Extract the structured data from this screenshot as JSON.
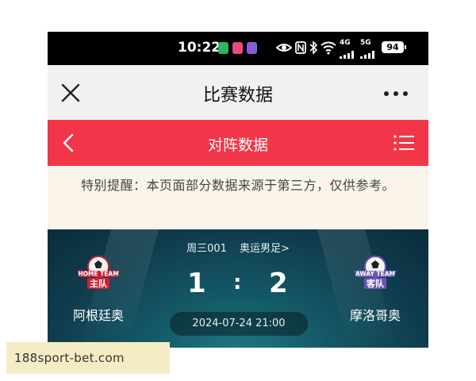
{
  "status_bar": {
    "time": "10:22",
    "battery": "94",
    "net_4g": "4G",
    "net_5g": "5G",
    "icons": [
      "app-green-icon",
      "app-pink-icon",
      "app-purple-icon",
      "eye-icon",
      "nfc-icon",
      "bluetooth-icon",
      "wifi-icon",
      "signal-icon",
      "battery-icon"
    ]
  },
  "nav": {
    "title": "比赛数据",
    "close_icon": "close-icon",
    "more_icon": "more-icon"
  },
  "header": {
    "title": "对阵数据",
    "back_icon": "chevron-left-icon",
    "menu_icon": "list-icon",
    "color": "#f2364a"
  },
  "notice": {
    "text": "特别提醒：本页面部分数据来源于第三方，仅供参考。"
  },
  "match": {
    "code": "周三001",
    "league": "奥运男足>",
    "home": {
      "name": "阿根廷奥",
      "badge_en": "HOME TEAM",
      "badge_cn": "主队",
      "score": "1"
    },
    "away": {
      "name": "摩洛哥奥",
      "badge_en": "AWAY TEAM",
      "badge_cn": "客队",
      "score": "2"
    },
    "separator": ":",
    "time": "2024-07-24 21:00"
  },
  "watermark": {
    "text": "188sport-bet.com"
  }
}
